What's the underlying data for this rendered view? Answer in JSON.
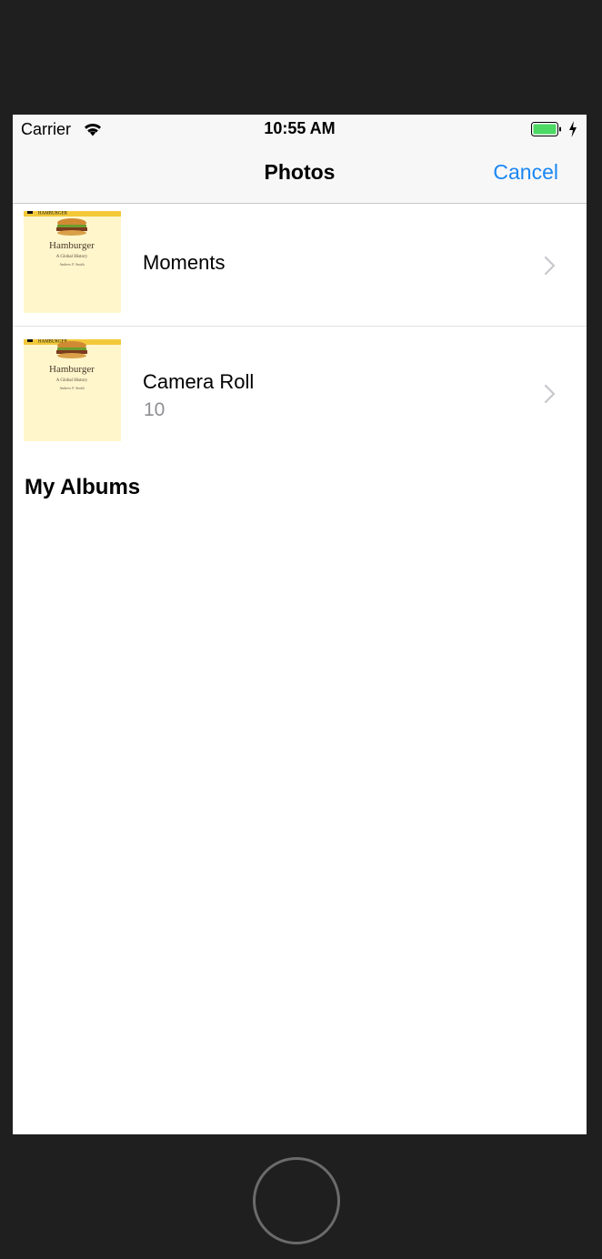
{
  "status_bar": {
    "carrier": "Carrier",
    "time": "10:55 AM",
    "battery_color": "#4cd964"
  },
  "nav": {
    "title": "Photos",
    "cancel_label": "Cancel",
    "accent_color": "#1b87f4"
  },
  "albums": [
    {
      "name": "Moments",
      "count": "",
      "thumbnail": {
        "cover_title": "Hamburger",
        "cover_subtitle": "A Global History",
        "cover_author": "Andrew F. Smith",
        "banner": "HAMBURGER"
      }
    },
    {
      "name": "Camera Roll",
      "count": "10",
      "thumbnail": {
        "cover_title": "Hamburger",
        "cover_subtitle": "A Global History",
        "cover_author": "Andrew F. Smith",
        "banner": "HAMBURGER"
      }
    }
  ],
  "sections": {
    "my_albums": "My Albums"
  },
  "icons": {
    "wifi": "wifi-icon",
    "battery": "battery-icon",
    "charging": "charging-bolt-icon",
    "chevron": "chevron-right-icon",
    "home": "home-button"
  }
}
